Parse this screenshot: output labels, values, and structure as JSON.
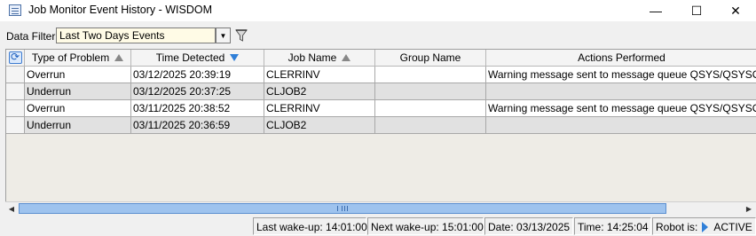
{
  "window": {
    "title": "Job Monitor Event History - WISDOM",
    "min_glyph": "—",
    "max_glyph": "☐",
    "close_glyph": "✕"
  },
  "filter": {
    "label": "Data Filter:",
    "selected": "Last Two Days Events",
    "dropdown_glyph": "▼",
    "icon": "funnel-icon"
  },
  "grid": {
    "columns": [
      "Type of Problem",
      "Time Detected",
      "Job Name",
      "Group Name",
      "Actions Performed"
    ],
    "rows": [
      {
        "type": "Overrun",
        "time": "03/12/2025 20:39:19",
        "job": "CLERRINV",
        "group": "",
        "actions": "Warning message sent to message queue QSYS/QSYSOPR"
      },
      {
        "type": "Underrun",
        "time": "03/12/2025 20:37:25",
        "job": "CLJOB2",
        "group": "",
        "actions": ""
      },
      {
        "type": "Overrun",
        "time": "03/11/2025 20:38:52",
        "job": "CLERRINV",
        "group": "",
        "actions": "Warning message sent to message queue QSYS/QSYSOPR"
      },
      {
        "type": "Underrun",
        "time": "03/11/2025 20:36:59",
        "job": "CLJOB2",
        "group": "",
        "actions": ""
      }
    ]
  },
  "scrollbar": {
    "left_glyph": "◀",
    "right_glyph": "▶"
  },
  "status": {
    "last_wakeup": "Last wake-up: 14:01:00",
    "next_wakeup": "Next wake-up: 15:01:00",
    "date": "Date:  03/13/2025",
    "time": "Time:  14:25:04",
    "robot_label": "Robot is:",
    "robot_state": "ACTIVE"
  },
  "colors": {
    "accent": "#2f7fd8",
    "row_white": "#ffffff",
    "row_gray": "#e1e1e1"
  }
}
